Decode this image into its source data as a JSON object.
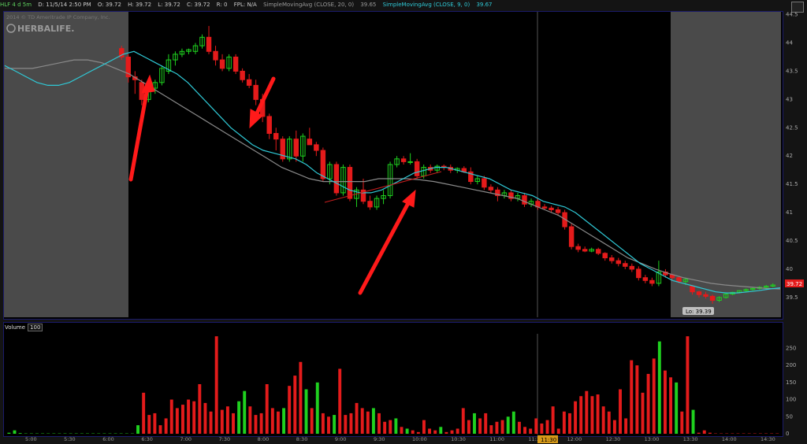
{
  "header": {
    "symbol": "HLF 4 d 5m",
    "date": "D: 11/5/14 2:50 PM",
    "open": "O: 39.72",
    "high": "H: 39.72",
    "low": "L: 39.72",
    "close": "C: 39.72",
    "range": "R: 0",
    "fpl": "FPL: N/A",
    "last": "39.65",
    "sma20_label": "SimpleMovingAvg (CLOSE, 20, 0)",
    "sma20_value": "39.65",
    "sma9_label": "SimpleMovingAvg (CLOSE, 9, 0)",
    "sma9_value": "39.67"
  },
  "watermark": {
    "copyright": "2014 © TD Ameritrade IP Company, Inc.",
    "brand": "HERBALIFE."
  },
  "volume_panel": {
    "label": "Volume",
    "value": "100"
  },
  "price_badge": "39.72",
  "low_badge": "Lo: 39.39",
  "time_badge": "11:30",
  "colors": {
    "up": "#1fd11f",
    "down": "#e41b1b",
    "sma9": "#2fc9d6",
    "sma20": "#8a8a8a",
    "arrow": "#ff1a1a",
    "panel_border": "#1b1b6a"
  },
  "chart_data": [
    {
      "type": "candlestick",
      "title": "HLF 4 d 5m",
      "y_ticks": [
        39.5,
        40,
        40.5,
        41,
        41.5,
        42,
        42.5,
        43,
        43.5,
        44,
        44.5
      ],
      "ylim": [
        39.15,
        44.55
      ],
      "x_ticks": [
        "5:00",
        "5:30",
        "6:00",
        "6:30",
        "7:00",
        "7:30",
        "8:00",
        "8:30",
        "9:00",
        "9:30",
        "10:00",
        "10:30",
        "11:00",
        "11:30",
        "12:00",
        "12:30",
        "13:00",
        "13:30",
        "14:00",
        "14:30"
      ],
      "candles": [
        [
          43.9,
          43.95,
          43.7,
          43.75
        ],
        [
          43.75,
          43.8,
          43.3,
          43.4
        ],
        [
          43.4,
          43.5,
          43.1,
          43.35
        ],
        [
          43.3,
          43.35,
          42.9,
          43.0
        ],
        [
          43.0,
          43.3,
          42.95,
          43.25
        ],
        [
          43.2,
          43.35,
          43.1,
          43.3
        ],
        [
          43.3,
          43.6,
          43.25,
          43.55
        ],
        [
          43.5,
          43.8,
          43.45,
          43.7
        ],
        [
          43.7,
          43.85,
          43.6,
          43.8
        ],
        [
          43.8,
          43.9,
          43.75,
          43.85
        ],
        [
          43.85,
          43.9,
          43.8,
          43.88
        ],
        [
          43.85,
          44.0,
          43.8,
          43.95
        ],
        [
          43.95,
          44.15,
          43.9,
          44.1
        ],
        [
          44.1,
          44.3,
          43.8,
          43.85
        ],
        [
          43.85,
          43.95,
          43.6,
          43.7
        ],
        [
          43.7,
          43.8,
          43.5,
          43.55
        ],
        [
          43.55,
          43.8,
          43.5,
          43.75
        ],
        [
          43.75,
          43.8,
          43.45,
          43.5
        ],
        [
          43.5,
          43.55,
          43.3,
          43.35
        ],
        [
          43.35,
          43.45,
          43.2,
          43.25
        ],
        [
          43.25,
          43.35,
          42.9,
          43.0
        ],
        [
          43.0,
          43.1,
          42.6,
          42.7
        ],
        [
          42.7,
          42.75,
          42.3,
          42.4
        ],
        [
          42.4,
          42.5,
          42.1,
          42.3
        ],
        [
          42.3,
          42.35,
          41.9,
          41.95
        ],
        [
          41.95,
          42.35,
          41.9,
          42.3
        ],
        [
          42.3,
          42.45,
          41.9,
          42.0
        ],
        [
          42.0,
          42.4,
          41.9,
          42.35
        ],
        [
          42.3,
          42.5,
          42.2,
          42.2
        ],
        [
          42.2,
          42.25,
          42.0,
          42.1
        ],
        [
          42.1,
          42.15,
          41.55,
          41.6
        ],
        [
          41.6,
          41.9,
          41.5,
          41.85
        ],
        [
          41.85,
          41.9,
          41.3,
          41.35
        ],
        [
          41.35,
          41.85,
          41.3,
          41.8
        ],
        [
          41.8,
          41.85,
          41.2,
          41.25
        ],
        [
          41.25,
          41.45,
          41.1,
          41.4
        ],
        [
          41.4,
          41.6,
          41.15,
          41.2
        ],
        [
          41.2,
          41.3,
          41.05,
          41.1
        ],
        [
          41.1,
          41.3,
          41.05,
          41.25
        ],
        [
          41.25,
          41.4,
          41.15,
          41.3
        ],
        [
          41.3,
          41.9,
          41.25,
          41.85
        ],
        [
          41.85,
          42.0,
          41.8,
          41.95
        ],
        [
          41.95,
          42.0,
          41.85,
          41.9
        ],
        [
          41.9,
          42.05,
          41.85,
          41.9
        ],
        [
          41.9,
          41.95,
          41.6,
          41.65
        ],
        [
          41.65,
          41.85,
          41.6,
          41.8
        ],
        [
          41.8,
          41.85,
          41.7,
          41.75
        ],
        [
          41.75,
          41.85,
          41.7,
          41.82
        ],
        [
          41.82,
          41.85,
          41.75,
          41.8
        ],
        [
          41.8,
          41.85,
          41.7,
          41.75
        ],
        [
          41.75,
          41.8,
          41.7,
          41.78
        ],
        [
          41.78,
          41.82,
          41.7,
          41.72
        ],
        [
          41.72,
          41.8,
          41.5,
          41.55
        ],
        [
          41.55,
          41.65,
          41.5,
          41.6
        ],
        [
          41.6,
          41.65,
          41.4,
          41.45
        ],
        [
          41.45,
          41.5,
          41.35,
          41.4
        ],
        [
          41.4,
          41.45,
          41.2,
          41.3
        ],
        [
          41.3,
          41.4,
          41.25,
          41.35
        ],
        [
          41.35,
          41.4,
          41.2,
          41.25
        ],
        [
          41.25,
          41.35,
          41.2,
          41.3
        ],
        [
          41.3,
          41.35,
          41.1,
          41.15
        ],
        [
          41.15,
          41.25,
          41.1,
          41.2
        ],
        [
          41.2,
          41.25,
          41.05,
          41.1
        ],
        [
          41.1,
          41.15,
          41.05,
          41.08
        ],
        [
          41.08,
          41.12,
          41.0,
          41.05
        ],
        [
          41.05,
          41.1,
          40.95,
          41.0
        ],
        [
          41.0,
          41.05,
          40.7,
          40.75
        ],
        [
          40.75,
          40.8,
          40.35,
          40.4
        ],
        [
          40.4,
          40.45,
          40.3,
          40.35
        ],
        [
          40.35,
          40.4,
          40.3,
          40.32
        ],
        [
          40.32,
          40.38,
          40.3,
          40.35
        ],
        [
          40.35,
          40.38,
          40.25,
          40.28
        ],
        [
          40.28,
          40.3,
          40.15,
          40.2
        ],
        [
          40.2,
          40.25,
          40.1,
          40.15
        ],
        [
          40.15,
          40.2,
          40.05,
          40.1
        ],
        [
          40.1,
          40.15,
          40.0,
          40.05
        ],
        [
          40.05,
          40.1,
          39.95,
          40.0
        ],
        [
          40.0,
          40.05,
          39.8,
          39.85
        ],
        [
          39.85,
          39.9,
          39.75,
          39.8
        ],
        [
          39.8,
          39.85,
          39.7,
          39.75
        ],
        [
          39.75,
          40.15,
          39.7,
          39.95
        ],
        [
          39.95,
          40.0,
          39.85,
          39.9
        ],
        [
          39.9,
          39.92,
          39.8,
          39.85
        ],
        [
          39.85,
          39.88,
          39.75,
          39.78
        ],
        [
          39.78,
          39.85,
          39.72,
          39.82
        ],
        [
          39.7,
          39.72,
          39.55,
          39.6
        ],
        [
          39.6,
          39.62,
          39.5,
          39.55
        ],
        [
          39.55,
          39.6,
          39.48,
          39.52
        ],
        [
          39.52,
          39.55,
          39.39,
          39.45
        ],
        [
          39.45,
          39.52,
          39.42,
          39.5
        ],
        [
          39.5,
          39.58,
          39.48,
          39.56
        ],
        [
          39.56,
          39.6,
          39.54,
          39.59
        ],
        [
          39.59,
          39.63,
          39.57,
          39.62
        ],
        [
          39.62,
          39.66,
          39.6,
          39.64
        ],
        [
          39.64,
          39.68,
          39.62,
          39.66
        ],
        [
          39.66,
          39.7,
          39.64,
          39.68
        ],
        [
          39.68,
          39.72,
          39.66,
          39.7
        ],
        [
          39.7,
          39.75,
          39.68,
          39.72
        ]
      ],
      "sma9": [
        43.6,
        43.5,
        43.4,
        43.3,
        43.25,
        43.25,
        43.3,
        43.4,
        43.5,
        43.6,
        43.7,
        43.8,
        43.85,
        43.75,
        43.65,
        43.55,
        43.45,
        43.3,
        43.1,
        42.9,
        42.7,
        42.5,
        42.35,
        42.2,
        42.1,
        42.05,
        42.0,
        41.95,
        41.85,
        41.7,
        41.6,
        41.5,
        41.4,
        41.35,
        41.35,
        41.4,
        41.5,
        41.6,
        41.7,
        41.75,
        41.8,
        41.8,
        41.75,
        41.7,
        41.65,
        41.6,
        41.5,
        41.4,
        41.35,
        41.3,
        41.2,
        41.15,
        41.1,
        41.0,
        40.85,
        40.7,
        40.55,
        40.4,
        40.25,
        40.1,
        40.0,
        39.9,
        39.8,
        39.75,
        39.7,
        39.65,
        39.6,
        39.58,
        39.58,
        39.6,
        39.62,
        39.65,
        39.67
      ],
      "sma20": [
        43.55,
        43.55,
        43.55,
        43.6,
        43.65,
        43.7,
        43.7,
        43.65,
        43.55,
        43.45,
        43.3,
        43.15,
        43.0,
        42.85,
        42.7,
        42.55,
        42.4,
        42.25,
        42.1,
        41.95,
        41.8,
        41.7,
        41.6,
        41.55,
        41.55,
        41.55,
        41.55,
        41.6,
        41.6,
        41.6,
        41.58,
        41.55,
        41.5,
        41.45,
        41.4,
        41.35,
        41.3,
        41.25,
        41.15,
        41.05,
        40.95,
        40.8,
        40.65,
        40.5,
        40.35,
        40.2,
        40.1,
        40.0,
        39.92,
        39.85,
        39.8,
        39.75,
        39.72,
        39.7,
        39.68,
        39.66,
        39.65
      ],
      "volume": {
        "y_ticks": [
          0,
          50,
          100,
          150,
          200,
          250
        ],
        "ylim": [
          0,
          290
        ],
        "bars": [
          [
            3,
            "g"
          ],
          [
            10,
            "g"
          ],
          [
            2,
            "g"
          ],
          [
            1,
            "g"
          ],
          [
            1,
            "g"
          ],
          [
            1,
            "g"
          ],
          [
            1,
            "g"
          ],
          [
            1,
            "g"
          ],
          [
            1,
            "g"
          ],
          [
            1,
            "g"
          ],
          [
            1,
            "g"
          ],
          [
            1,
            "g"
          ],
          [
            1,
            "g"
          ],
          [
            1,
            "g"
          ],
          [
            1,
            "g"
          ],
          [
            1,
            "g"
          ],
          [
            1,
            "g"
          ],
          [
            1,
            "g"
          ],
          [
            1,
            "g"
          ],
          [
            1,
            "g"
          ],
          [
            1,
            "g"
          ],
          [
            1,
            "g"
          ],
          [
            1,
            "g"
          ],
          [
            25,
            "g"
          ],
          [
            120,
            "r"
          ],
          [
            55,
            "r"
          ],
          [
            60,
            "r"
          ],
          [
            25,
            "r"
          ],
          [
            45,
            "r"
          ],
          [
            100,
            "r"
          ],
          [
            75,
            "r"
          ],
          [
            85,
            "r"
          ],
          [
            100,
            "r"
          ],
          [
            95,
            "r"
          ],
          [
            145,
            "r"
          ],
          [
            90,
            "r"
          ],
          [
            65,
            "r"
          ],
          [
            285,
            "r"
          ],
          [
            70,
            "r"
          ],
          [
            80,
            "r"
          ],
          [
            60,
            "r"
          ],
          [
            95,
            "g"
          ],
          [
            125,
            "g"
          ],
          [
            80,
            "r"
          ],
          [
            55,
            "r"
          ],
          [
            60,
            "r"
          ],
          [
            145,
            "r"
          ],
          [
            75,
            "r"
          ],
          [
            65,
            "r"
          ],
          [
            75,
            "g"
          ],
          [
            140,
            "r"
          ],
          [
            170,
            "r"
          ],
          [
            210,
            "r"
          ],
          [
            130,
            "g"
          ],
          [
            75,
            "r"
          ],
          [
            150,
            "g"
          ],
          [
            60,
            "r"
          ],
          [
            50,
            "r"
          ],
          [
            55,
            "g"
          ],
          [
            190,
            "r"
          ],
          [
            55,
            "r"
          ],
          [
            60,
            "r"
          ],
          [
            90,
            "r"
          ],
          [
            75,
            "r"
          ],
          [
            65,
            "r"
          ],
          [
            75,
            "g"
          ],
          [
            60,
            "r"
          ],
          [
            35,
            "r"
          ],
          [
            40,
            "r"
          ],
          [
            45,
            "g"
          ],
          [
            20,
            "r"
          ],
          [
            15,
            "g"
          ],
          [
            10,
            "r"
          ],
          [
            5,
            "r"
          ],
          [
            40,
            "r"
          ],
          [
            15,
            "r"
          ],
          [
            10,
            "r"
          ],
          [
            20,
            "g"
          ],
          [
            5,
            "r"
          ],
          [
            10,
            "r"
          ],
          [
            15,
            "r"
          ],
          [
            75,
            "r"
          ],
          [
            40,
            "r"
          ],
          [
            60,
            "g"
          ],
          [
            45,
            "r"
          ],
          [
            60,
            "r"
          ],
          [
            25,
            "r"
          ],
          [
            35,
            "r"
          ],
          [
            40,
            "r"
          ],
          [
            50,
            "g"
          ],
          [
            65,
            "g"
          ],
          [
            35,
            "r"
          ],
          [
            20,
            "r"
          ],
          [
            15,
            "r"
          ],
          [
            45,
            "r"
          ],
          [
            30,
            "r"
          ],
          [
            40,
            "r"
          ],
          [
            80,
            "r"
          ],
          [
            15,
            "r"
          ],
          [
            65,
            "r"
          ],
          [
            60,
            "r"
          ],
          [
            95,
            "r"
          ],
          [
            110,
            "r"
          ],
          [
            125,
            "r"
          ],
          [
            110,
            "r"
          ],
          [
            115,
            "r"
          ],
          [
            80,
            "r"
          ],
          [
            65,
            "r"
          ],
          [
            40,
            "r"
          ],
          [
            130,
            "r"
          ],
          [
            45,
            "r"
          ],
          [
            215,
            "r"
          ],
          [
            200,
            "r"
          ],
          [
            120,
            "r"
          ],
          [
            175,
            "r"
          ],
          [
            220,
            "r"
          ],
          [
            270,
            "g"
          ],
          [
            185,
            "r"
          ],
          [
            165,
            "r"
          ],
          [
            150,
            "g"
          ],
          [
            65,
            "r"
          ],
          [
            285,
            "r"
          ],
          [
            70,
            "g"
          ],
          [
            3,
            "r"
          ],
          [
            10,
            "r"
          ],
          [
            3,
            "r"
          ],
          [
            1,
            "r"
          ],
          [
            1,
            "r"
          ],
          [
            1,
            "r"
          ],
          [
            1,
            "r"
          ],
          [
            1,
            "r"
          ],
          [
            1,
            "r"
          ],
          [
            1,
            "r"
          ],
          [
            1,
            "r"
          ],
          [
            1,
            "r"
          ],
          [
            1,
            "r"
          ],
          [
            1,
            "r"
          ],
          [
            1,
            "r"
          ]
        ]
      }
    }
  ]
}
